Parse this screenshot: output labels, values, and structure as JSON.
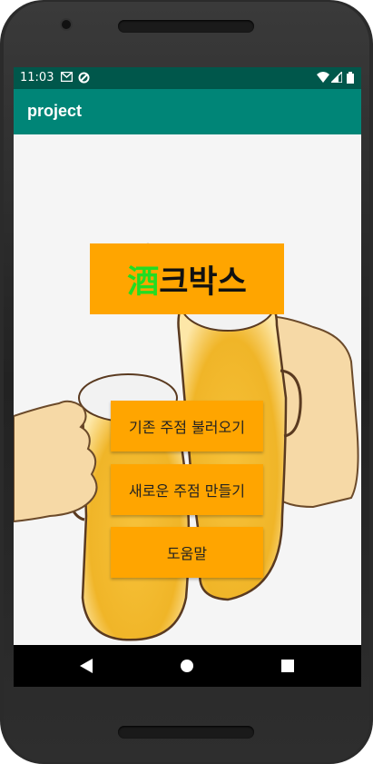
{
  "status_bar": {
    "time": "11:03",
    "left_icons": [
      "gmail-icon",
      "data-saver-icon"
    ],
    "right_icons": [
      "wifi-icon",
      "cell-signal-icon",
      "battery-icon"
    ]
  },
  "app_bar": {
    "title": "project"
  },
  "main": {
    "title_hanja": "酒",
    "title_rest": "크박스",
    "buttons": [
      {
        "label": "기존 주점 불러오기"
      },
      {
        "label": "새로운 주점 만들기"
      },
      {
        "label": "도움말"
      }
    ]
  },
  "nav_bar": {
    "icons": [
      "back-icon",
      "home-icon",
      "recents-icon"
    ]
  },
  "colors": {
    "status_bar": "#00574b",
    "app_bar": "#008577",
    "accent_orange": "#ffa500",
    "hanja_green": "#22dd22"
  }
}
